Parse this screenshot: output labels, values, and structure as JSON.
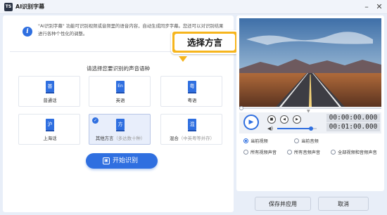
{
  "window": {
    "app_icon_text": "TS",
    "title": "AI识别字幕",
    "minimize_icon": "minimize-icon",
    "close_icon": "close-icon"
  },
  "info": {
    "icon": "info-icon",
    "text": "\"AI识别字幕\" 功能可识别视频或音频里的语音内容，自动生成同步字幕。您还可以对识别结果进行各种个性化的调整。"
  },
  "callout": {
    "text": "选择方言"
  },
  "language_section": {
    "title": "请选择您要识别的声音语种",
    "options": [
      {
        "icon_char": "普",
        "label": "普通话",
        "sub": "",
        "selected": false
      },
      {
        "icon_char": "En",
        "label": "英语",
        "sub": "",
        "selected": false
      },
      {
        "icon_char": "粤",
        "label": "粤语",
        "sub": "",
        "selected": false
      },
      {
        "icon_char": "沪",
        "label": "上海话",
        "sub": "",
        "selected": false
      },
      {
        "icon_char": "方",
        "label": "其他方言",
        "sub": "（多达数十种）",
        "selected": true
      },
      {
        "icon_char": "混",
        "label": "混合",
        "sub": "（中英粤等并存）",
        "selected": false
      }
    ]
  },
  "start_button": {
    "label": "开始识别",
    "icon": "start-recognize-icon"
  },
  "player": {
    "progress": 0.0,
    "volume": 0.85,
    "current_time": "00:00:00.000",
    "total_time": "00:01:00.000"
  },
  "audio_scope": {
    "options": [
      {
        "label": "当前视频",
        "checked": true
      },
      {
        "label": "当前音频",
        "checked": false
      },
      {
        "label": "所有视频声音",
        "checked": false
      },
      {
        "label": "所有音频声音",
        "checked": false
      },
      {
        "label": "全部视频和音频声音",
        "checked": false
      }
    ]
  },
  "footer": {
    "apply_label": "保存并应用",
    "cancel_label": "取消"
  },
  "colors": {
    "accent": "#2f6fe0",
    "callout": "#f6b51d"
  }
}
